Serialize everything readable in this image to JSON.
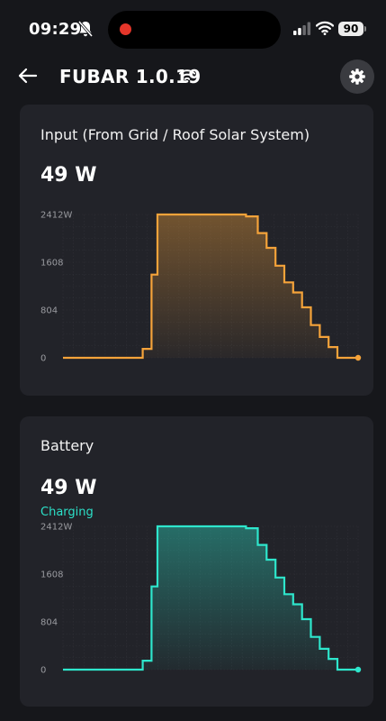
{
  "status_bar": {
    "time": "09:29",
    "battery_level": "90",
    "colors": {
      "recording_dot": "#e5362a"
    }
  },
  "header": {
    "title": "FUBAR 1.0.19",
    "back_icon": "arrow-left-icon",
    "settings_icon": "gear-icon",
    "connection_icon": "wifi-icon"
  },
  "input_card": {
    "title": "Input (From Grid / Roof Solar System)",
    "value": "49 W"
  },
  "battery_card": {
    "title": "Battery",
    "value": "49 W",
    "status": "Charging"
  },
  "chart_data": [
    {
      "type": "area",
      "name": "input",
      "color": "#f5a33a",
      "title": "",
      "xlabel": "",
      "ylabel": "",
      "yticks": [
        0,
        804,
        1608,
        2412
      ],
      "ytick_labels": [
        "0",
        "804",
        "1608",
        "2412W"
      ],
      "ylim": [
        0,
        2412
      ],
      "xlim": [
        0,
        100
      ],
      "grid": true,
      "x": [
        0,
        27,
        27,
        30,
        30,
        32,
        32,
        35,
        35,
        62,
        62,
        66,
        66,
        69,
        69,
        72,
        72,
        75,
        75,
        78,
        78,
        81,
        81,
        84,
        84,
        87,
        87,
        90,
        90,
        93,
        93,
        97,
        97,
        100
      ],
      "y": [
        0,
        0,
        150,
        150,
        1400,
        1400,
        2412,
        2412,
        2412,
        2412,
        2380,
        2380,
        2100,
        2100,
        1850,
        1850,
        1550,
        1550,
        1270,
        1270,
        1100,
        1100,
        850,
        850,
        550,
        550,
        350,
        350,
        180,
        180,
        0,
        0,
        0,
        0
      ]
    },
    {
      "type": "area",
      "name": "battery",
      "color": "#2ee6cc",
      "title": "",
      "xlabel": "",
      "ylabel": "",
      "yticks": [
        0,
        804,
        1608,
        2412
      ],
      "ytick_labels": [
        "0",
        "804",
        "1608",
        "2412W"
      ],
      "ylim": [
        0,
        2412
      ],
      "xlim": [
        0,
        100
      ],
      "grid": true,
      "x": [
        0,
        27,
        27,
        30,
        30,
        32,
        32,
        35,
        35,
        62,
        62,
        66,
        66,
        69,
        69,
        72,
        72,
        75,
        75,
        78,
        78,
        81,
        81,
        84,
        84,
        87,
        87,
        90,
        90,
        93,
        93,
        97,
        97,
        100
      ],
      "y": [
        0,
        0,
        150,
        150,
        1400,
        1400,
        2412,
        2412,
        2412,
        2412,
        2380,
        2380,
        2100,
        2100,
        1850,
        1850,
        1550,
        1550,
        1270,
        1270,
        1100,
        1100,
        850,
        850,
        550,
        550,
        350,
        350,
        180,
        180,
        0,
        0,
        0,
        0
      ]
    }
  ]
}
